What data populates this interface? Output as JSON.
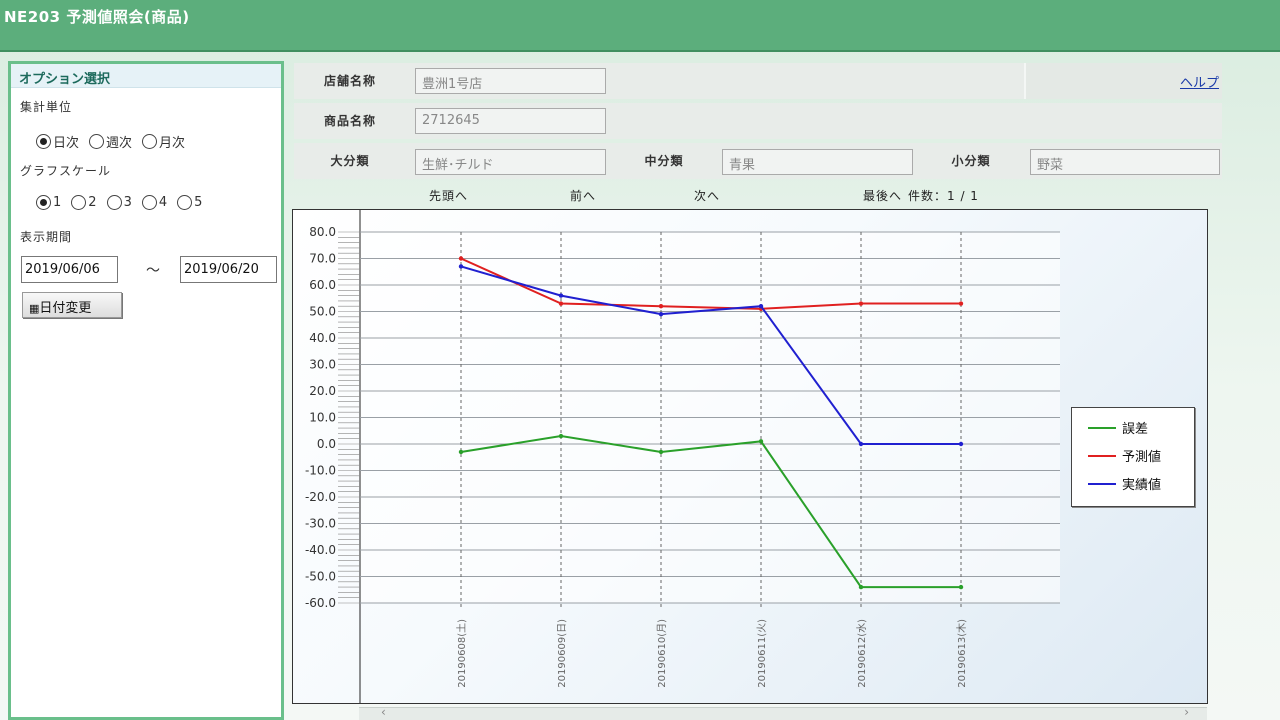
{
  "window": {
    "title": "NE203 予測値照会(商品)"
  },
  "options": {
    "header": "オプション選択",
    "aggregation_label": "集計単位",
    "aggregation_options": [
      "日次",
      "週次",
      "月次"
    ],
    "aggregation_selected": 0,
    "scale_label": "グラフスケール",
    "scale_options": [
      "1",
      "2",
      "3",
      "4",
      "5"
    ],
    "scale_selected": 0,
    "period_label": "表示期間",
    "date_from": "2019/06/06",
    "date_tilde": "～",
    "date_to": "2019/06/20",
    "change_date_button": "日付変更"
  },
  "form": {
    "store_label": "店舗名称",
    "store_value": "豊洲1号店",
    "product_label": "商品名称",
    "product_value": "2712645",
    "major_label": "大分類",
    "major_value": "生鮮･チルド",
    "middle_label": "中分類",
    "middle_value": "青果",
    "minor_label": "小分類",
    "minor_value": "野菜",
    "help_link": "ヘルプ"
  },
  "nav": {
    "first": "先頭へ",
    "prev": "前へ",
    "next": "次へ",
    "last": "最後へ",
    "count": "件数：1 / 1"
  },
  "chart_data": {
    "type": "line",
    "categories": [
      "20190608(土)",
      "20190609(日)",
      "20190610(月)",
      "20190611(火)",
      "20190612(水)",
      "20190613(木)"
    ],
    "ylim": [
      -60,
      80
    ],
    "yticks": [
      "80.0",
      "70.0",
      "60.0",
      "50.0",
      "40.0",
      "30.0",
      "20.0",
      "10.0",
      "0.0",
      "-10.0",
      "-20.0",
      "-30.0",
      "-40.0",
      "-50.0",
      "-60.0"
    ],
    "legend_position": "right",
    "series": [
      {
        "name": "誤差",
        "color": "#2aa02a",
        "values": [
          -3,
          3,
          -3,
          1,
          -54,
          -54
        ]
      },
      {
        "name": "予測値",
        "color": "#e02020",
        "values": [
          70,
          53,
          52,
          51,
          53,
          53
        ]
      },
      {
        "name": "実績値",
        "color": "#2020d0",
        "values": [
          67,
          56,
          49,
          52,
          0,
          0
        ]
      }
    ]
  }
}
